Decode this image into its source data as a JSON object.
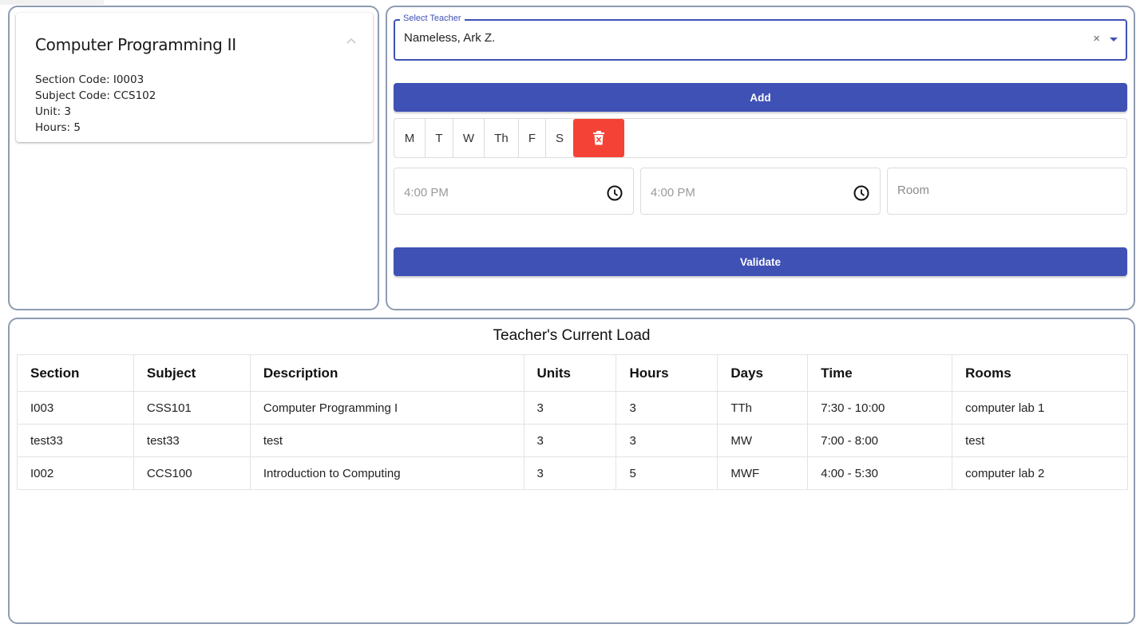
{
  "course": {
    "title": "Computer Programming II",
    "section_code": "Section Code: I0003",
    "subject_code": "Subject Code: CCS102",
    "unit": "Unit: 3",
    "hours": "Hours: 5",
    "collapse_icon": "chevron-up-icon"
  },
  "teacher_select": {
    "label": "Select Teacher",
    "value": "Nameless, Ark Z.",
    "clear": "×",
    "accent_color": "#3f51b5"
  },
  "actions": {
    "add_label": "Add",
    "validate_label": "Validate"
  },
  "days": [
    "M",
    "T",
    "W",
    "Th",
    "F",
    "S"
  ],
  "delete_icon": "trash-icon",
  "delete_color": "#f44336",
  "schedule": {
    "start_time_placeholder": "4:00 PM",
    "end_time_placeholder": "4:00 PM",
    "room_placeholder": "Room",
    "time_icon": "clock-icon"
  },
  "load": {
    "title": "Teacher's Current Load",
    "columns": [
      "Section",
      "Subject",
      "Description",
      "Units",
      "Hours",
      "Days",
      "Time",
      "Rooms"
    ],
    "rows": [
      [
        "I003",
        "CSS101",
        "Computer Programming I",
        "3",
        "3",
        "TTh",
        "7:30 - 10:00",
        "computer lab 1"
      ],
      [
        "test33",
        "test33",
        "test",
        "3",
        "3",
        "MW",
        "7:00 - 8:00",
        "test"
      ],
      [
        "I002",
        "CCS100",
        "Introduction to Computing",
        "3",
        "5",
        "MWF",
        "4:00 - 5:30",
        "computer lab 2"
      ]
    ]
  }
}
